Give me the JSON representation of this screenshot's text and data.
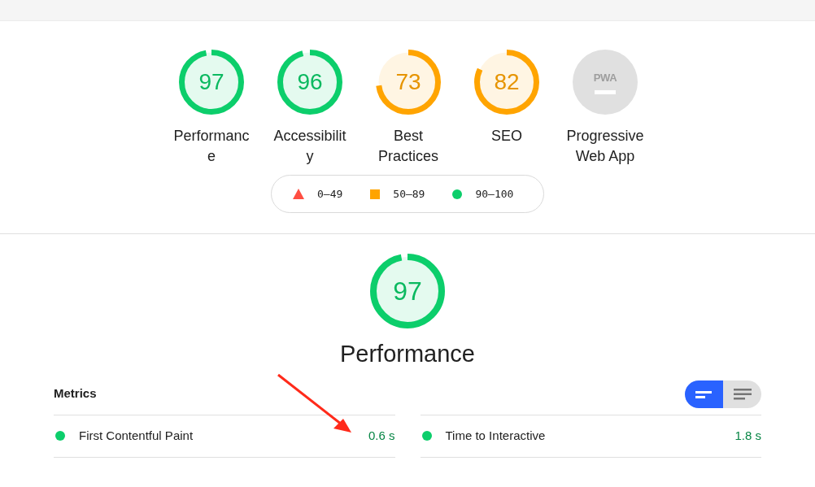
{
  "categories": [
    {
      "kind": "score",
      "score": "97",
      "label": "Performance",
      "color": "#0cce6b"
    },
    {
      "kind": "score",
      "score": "96",
      "label": "Accessibility",
      "color": "#0cce6b"
    },
    {
      "kind": "score",
      "score": "73",
      "label": "Best Practices",
      "color": "#ffa400"
    },
    {
      "kind": "score",
      "score": "82",
      "label": "SEO",
      "color": "#ffa400"
    },
    {
      "kind": "pwa",
      "badge": "PWA",
      "label": "Progressive Web App"
    }
  ],
  "legend": [
    {
      "kind": "fail",
      "range": "0–49"
    },
    {
      "kind": "average",
      "range": "50–89"
    },
    {
      "kind": "pass",
      "range": "90–100"
    }
  ],
  "section": {
    "score": "97",
    "color": "#0cce6b",
    "title": "Performance"
  },
  "metrics": {
    "title": "Metrics",
    "view_toggle": [
      {
        "selected": true
      },
      {
        "selected": false
      }
    ],
    "items": [
      {
        "label": "First Contentful Paint",
        "value": "0.6 s",
        "color": "#0cce6b"
      },
      {
        "label": "Time to Interactive",
        "value": "1.8 s",
        "color": "#0cce6b"
      }
    ]
  }
}
